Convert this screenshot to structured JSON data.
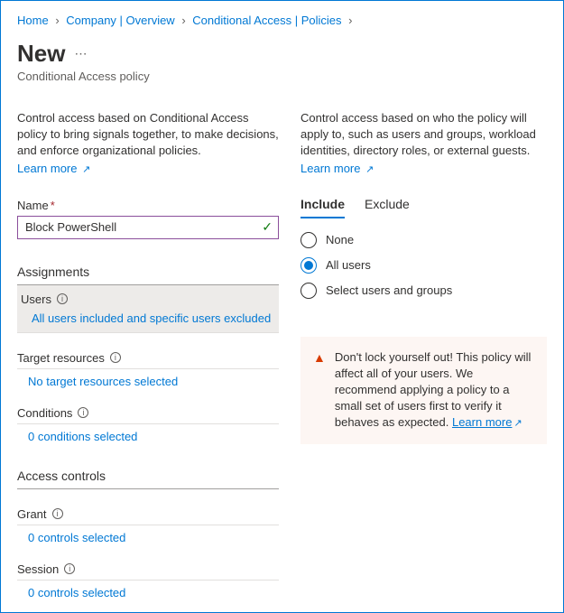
{
  "breadcrumb": {
    "items": [
      {
        "label": "Home"
      },
      {
        "label": "Company | Overview"
      },
      {
        "label": "Conditional Access | Policies"
      }
    ]
  },
  "header": {
    "title": "New",
    "subtitle": "Conditional Access policy"
  },
  "left": {
    "intro": "Control access based on Conditional Access policy to bring signals together, to make decisions, and enforce organizational policies.",
    "learn_more": "Learn more",
    "name_label": "Name",
    "name_value": "Block PowerShell",
    "assignments_header": "Assignments",
    "users": {
      "label": "Users",
      "value": "All users included and specific users excluded"
    },
    "target": {
      "label": "Target resources",
      "value": "No target resources selected"
    },
    "conditions": {
      "label": "Conditions",
      "value": "0 conditions selected"
    },
    "access_header": "Access controls",
    "grant": {
      "label": "Grant",
      "value": "0 controls selected"
    },
    "session": {
      "label": "Session",
      "value": "0 controls selected"
    }
  },
  "right": {
    "intro": "Control access based on who the policy will apply to, such as users and groups, workload identities, directory roles, or external guests.",
    "learn_more": "Learn more",
    "tabs": {
      "include": "Include",
      "exclude": "Exclude"
    },
    "radios": {
      "none": "None",
      "all": "All users",
      "select": "Select users and groups"
    },
    "warning": {
      "text": "Don't lock yourself out! This policy will affect all of your users. We recommend applying a policy to a small set of users first to verify it behaves as expected.",
      "link": "Learn more"
    }
  }
}
